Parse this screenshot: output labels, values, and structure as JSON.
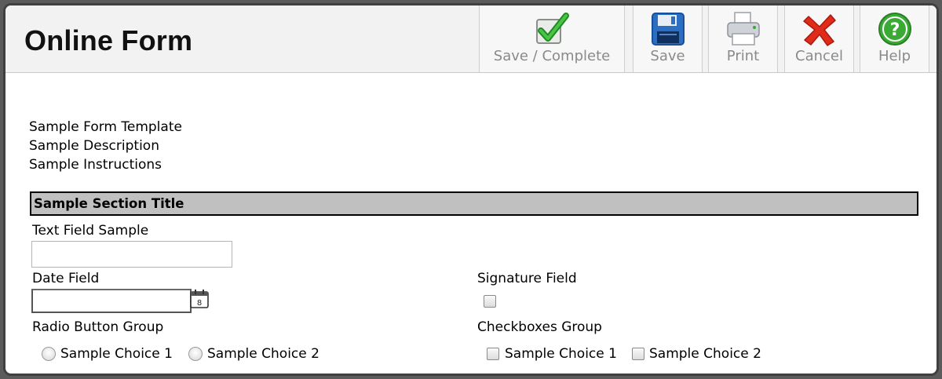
{
  "header": {
    "title": "Online Form"
  },
  "toolbar": {
    "save_complete": {
      "label": "Save / Complete",
      "icon": "check-icon"
    },
    "save": {
      "label": "Save",
      "icon": "floppy-disk-icon"
    },
    "print": {
      "label": "Print",
      "icon": "printer-icon"
    },
    "cancel": {
      "label": "Cancel",
      "icon": "red-x-icon"
    },
    "help": {
      "label": "Help",
      "icon": "question-icon"
    }
  },
  "form": {
    "template": "Sample Form Template",
    "description": "Sample Description",
    "instructions": "Sample Instructions",
    "section_title": "Sample Section Title",
    "text_field": {
      "label": "Text Field Sample",
      "value": ""
    },
    "date_field": {
      "label": "Date Field",
      "value": ""
    },
    "signature_field": {
      "label": "Signature Field"
    },
    "radio_group": {
      "label": "Radio Button Group",
      "choices": [
        "Sample Choice 1",
        "Sample Choice 2"
      ]
    },
    "checkbox_group": {
      "label": "Checkboxes Group",
      "choices": [
        "Sample Choice 1",
        "Sample Choice 2"
      ]
    }
  },
  "colors": {
    "section_bar": "#c0c0c0",
    "header_bg": "#f2f2f2",
    "check_green": "#2eaa2e",
    "floppy_blue": "#2b6fc4",
    "cancel_red": "#e02a1a",
    "help_green": "#3aaa35"
  }
}
